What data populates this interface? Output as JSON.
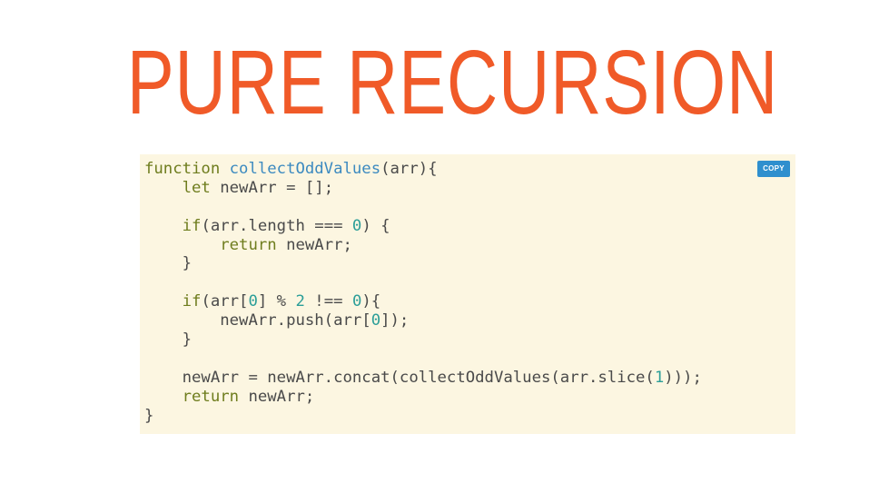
{
  "slide": {
    "title": "PURE RECURSION"
  },
  "code_block": {
    "copy_label": "COPY",
    "colors": {
      "background": "#fcf6e1",
      "keyword": "#6f7d1e",
      "function_name": "#3c8ac0",
      "number": "#2b9e98",
      "text": "#4a4a4a",
      "copy_button": "#2f8fce",
      "title": "#f05a28"
    },
    "lines": [
      [
        [
          "kw",
          "function"
        ],
        [
          "plain",
          " "
        ],
        [
          "fn",
          "collectOddValues"
        ],
        [
          "plain",
          "(arr){"
        ]
      ],
      [
        [
          "plain",
          "    "
        ],
        [
          "kw",
          "let"
        ],
        [
          "plain",
          " newArr = [];"
        ]
      ],
      [
        [
          "plain",
          ""
        ]
      ],
      [
        [
          "plain",
          "    "
        ],
        [
          "kw",
          "if"
        ],
        [
          "plain",
          "(arr.length === "
        ],
        [
          "num",
          "0"
        ],
        [
          "plain",
          ") {"
        ]
      ],
      [
        [
          "plain",
          "        "
        ],
        [
          "kw",
          "return"
        ],
        [
          "plain",
          " newArr;"
        ]
      ],
      [
        [
          "plain",
          "    }"
        ]
      ],
      [
        [
          "plain",
          ""
        ]
      ],
      [
        [
          "plain",
          "    "
        ],
        [
          "kw",
          "if"
        ],
        [
          "plain",
          "(arr["
        ],
        [
          "num",
          "0"
        ],
        [
          "plain",
          "] % "
        ],
        [
          "num",
          "2"
        ],
        [
          "plain",
          " !== "
        ],
        [
          "num",
          "0"
        ],
        [
          "plain",
          "){"
        ]
      ],
      [
        [
          "plain",
          "        newArr.push(arr["
        ],
        [
          "num",
          "0"
        ],
        [
          "plain",
          "]);"
        ]
      ],
      [
        [
          "plain",
          "    }"
        ]
      ],
      [
        [
          "plain",
          ""
        ]
      ],
      [
        [
          "plain",
          "    newArr = newArr.concat(collectOddValues(arr.slice("
        ],
        [
          "num",
          "1"
        ],
        [
          "plain",
          ")));"
        ]
      ],
      [
        [
          "plain",
          "    "
        ],
        [
          "kw",
          "return"
        ],
        [
          "plain",
          " newArr;"
        ]
      ],
      [
        [
          "plain",
          "}"
        ]
      ]
    ]
  }
}
